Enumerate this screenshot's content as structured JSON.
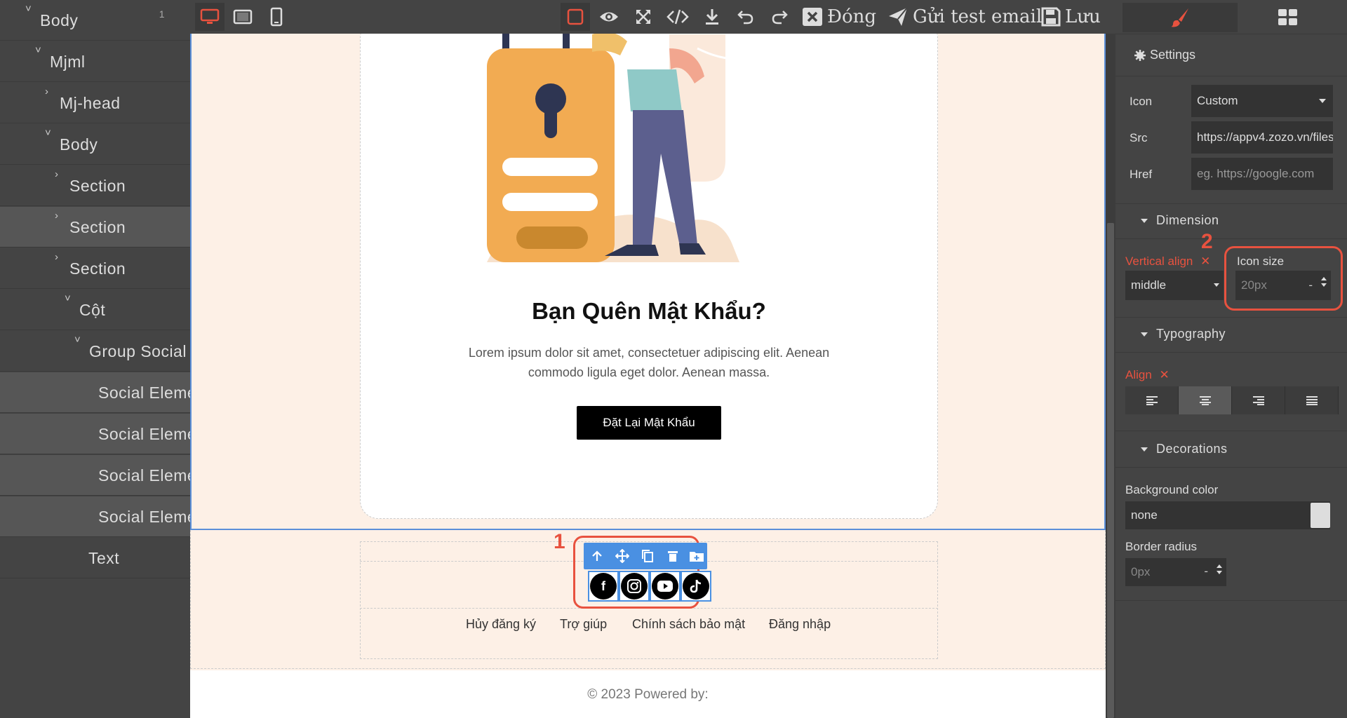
{
  "layers": [
    {
      "label": "Body",
      "count": "1",
      "caret": "˅"
    },
    {
      "label": "Mjml",
      "caret": "˅"
    },
    {
      "label": "Mj-head",
      "caret": "›"
    },
    {
      "label": "Body",
      "caret": "˅"
    },
    {
      "label": "Section",
      "caret": "›"
    },
    {
      "label": "Section",
      "caret": "›"
    },
    {
      "label": "Section",
      "caret": "›"
    },
    {
      "label": "Cột",
      "caret": "˅"
    },
    {
      "label": "Group Social",
      "caret": "˅"
    },
    {
      "label": "Social Element"
    },
    {
      "label": "Social Element"
    },
    {
      "label": "Social Element"
    },
    {
      "label": "Social Element"
    },
    {
      "label": "Text"
    }
  ],
  "toolbar": {
    "close_label": "Đóng",
    "send_test_label": "Gửi test email",
    "save_label": "Lưu"
  },
  "email": {
    "heading": "Bạn Quên Mật Khẩu?",
    "body_line1": "Lorem ipsum dolor sit amet, consectetuer adipiscing elit. Aenean",
    "body_line2": "commodo ligula eget dolor. Aenean massa.",
    "button_label": "Đặt Lại Mật Khẩu",
    "footer_links": [
      "Hủy đăng ký",
      "Trợ giúp",
      "Chính sách bảo mật",
      "Đăng nhập"
    ],
    "copyright": "© 2023 Powered by:"
  },
  "annotations": {
    "one": "1",
    "two": "2"
  },
  "settings": {
    "title": "Settings",
    "icon_label": "Icon",
    "icon_value": "Custom",
    "src_label": "Src",
    "src_value": "https://appv4.zozo.vn/files",
    "href_label": "Href",
    "href_placeholder": "eg. https://google.com",
    "dimension_title": "Dimension",
    "valign_label": "Vertical align",
    "valign_value": "middle",
    "iconsize_label": "Icon size",
    "iconsize_placeholder": "20px",
    "typography_title": "Typography",
    "align_label": "Align",
    "decorations_title": "Decorations",
    "bgcolor_label": "Background color",
    "bgcolor_value": "none",
    "radius_label": "Border radius",
    "radius_placeholder": "0px"
  },
  "colors": {
    "accent": "#e8523f",
    "selection": "#4a90e2",
    "panel": "#444444"
  }
}
